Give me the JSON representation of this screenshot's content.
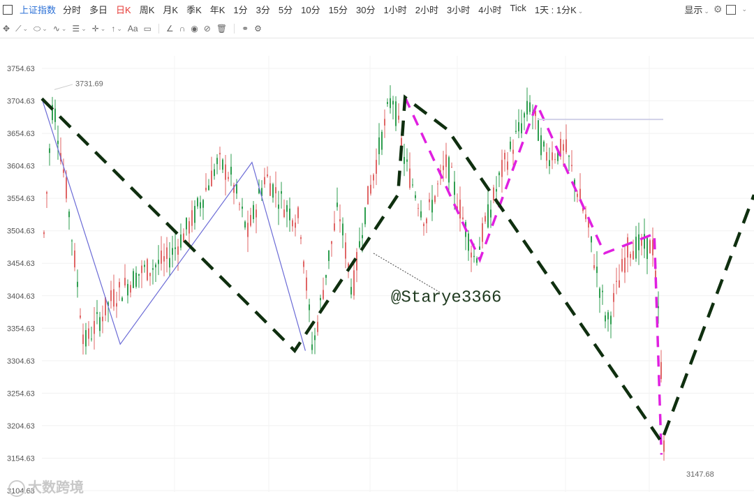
{
  "toolbar": {
    "index_name": "上证指数",
    "timeframes": [
      {
        "label": "分时",
        "active": false
      },
      {
        "label": "多日",
        "active": false
      },
      {
        "label": "日K",
        "active": true
      },
      {
        "label": "周K",
        "active": false
      },
      {
        "label": "月K",
        "active": false
      },
      {
        "label": "季K",
        "active": false
      },
      {
        "label": "年K",
        "active": false
      },
      {
        "label": "1分",
        "active": false
      },
      {
        "label": "3分",
        "active": false
      },
      {
        "label": "5分",
        "active": false
      },
      {
        "label": "10分",
        "active": false
      },
      {
        "label": "15分",
        "active": false
      },
      {
        "label": "30分",
        "active": false
      },
      {
        "label": "1小时",
        "active": false
      },
      {
        "label": "2小时",
        "active": false
      },
      {
        "label": "3小时",
        "active": false
      },
      {
        "label": "4小时",
        "active": false
      },
      {
        "label": "Tick",
        "active": false
      }
    ],
    "period_select": "1天 : 1分K",
    "display_label": "显示"
  },
  "drawing_tools": [
    "move-tool",
    "line-tool",
    "ellipse-tool",
    "wave-tool",
    "fib-tool",
    "cross-tool",
    "arrow-tool",
    "text-tool",
    "comment-tool",
    "angle-tool",
    "arc-tool",
    "eye-tool",
    "eraser-tool",
    "trash-tool",
    "link-tool",
    "settings-tool"
  ],
  "chart_data": {
    "type": "candlestick",
    "y_ticks": [
      "3754.63",
      "3704.63",
      "3654.63",
      "3604.63",
      "3554.63",
      "3504.63",
      "3454.63",
      "3404.63",
      "3354.63",
      "3304.63",
      "3254.63",
      "3204.63",
      "3154.63",
      "3104.63"
    ],
    "ylim": [
      3110,
      3760
    ],
    "high_label": "3731.69",
    "low_label": "3147.68",
    "annotation": "@Starye3366",
    "colors": {
      "up": "#e06666",
      "down": "#2e9e4f",
      "green_dash": "#0f2f0f",
      "magenta_dash": "#e020e0",
      "blue_line": "#6b6bd6"
    },
    "green_dashed_path": [
      [
        0,
        3708
      ],
      [
        0.355,
        3320
      ],
      [
        0.5,
        3560
      ],
      [
        0.51,
        3710
      ],
      [
        0.57,
        3660
      ],
      [
        0.87,
        3180
      ],
      [
        1,
        3560
      ]
    ],
    "magenta_dashed_path": [
      [
        0.51,
        3710
      ],
      [
        0.615,
        3460
      ],
      [
        0.695,
        3700
      ],
      [
        0.79,
        3470
      ],
      [
        0.86,
        3500
      ],
      [
        0.87,
        3160
      ]
    ],
    "blue_line_path": [
      [
        0,
        3708
      ],
      [
        0.11,
        3330
      ],
      [
        0.295,
        3610
      ],
      [
        0.37,
        3320
      ]
    ]
  },
  "watermark": "大数跨境"
}
